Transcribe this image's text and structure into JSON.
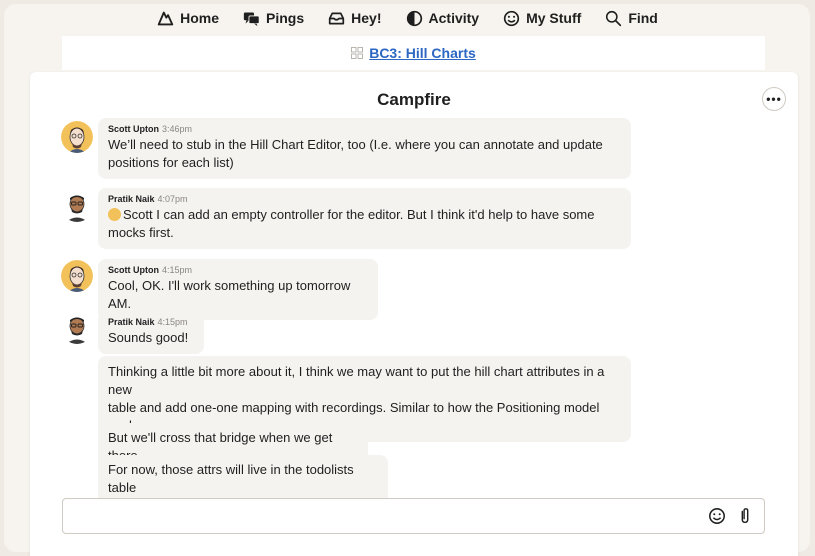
{
  "nav": {
    "items": [
      {
        "label": "Home",
        "icon": "home-icon"
      },
      {
        "label": "Pings",
        "icon": "pings-icon"
      },
      {
        "label": "Hey!",
        "icon": "hey-icon"
      },
      {
        "label": "Activity",
        "icon": "activity-icon"
      },
      {
        "label": "My Stuff",
        "icon": "my-stuff-icon"
      },
      {
        "label": "Find",
        "icon": "search-icon"
      }
    ]
  },
  "project": {
    "name": "BC3: Hill Charts",
    "icon": "project-grid-icon"
  },
  "campfire": {
    "title": "Campfire",
    "messages": [
      {
        "author": "Scott Upton",
        "time": "3:46pm",
        "lines": [
          "We’ll need to stub in the Hill Chart Editor, too (I.e. where you can annotate and update",
          "positions for each list)"
        ]
      },
      {
        "author": "Pratik Naik",
        "time": "4:07pm",
        "mention": "Scott",
        "lines": [
          "I can add an empty controller for the editor. But I think it'd help to have some",
          "mocks first."
        ]
      },
      {
        "author": "Scott Upton",
        "time": "4:15pm",
        "lines": [
          "Cool, OK. I'll work something up tomorrow AM."
        ]
      },
      {
        "author": "Pratik Naik",
        "time": "4:15pm",
        "lines": [
          "Sounds good!"
        ]
      },
      {
        "lines": [
          "Thinking a little bit more about it, I think we may want to put the hill chart attributes in a new",
          "table and add one-one mapping with recordings. Similar to how the Positioning model",
          "works."
        ]
      },
      {
        "lines": [
          "But we'll cross that bridge when we get there"
        ]
      },
      {
        "lines": [
          "For now, those attrs will live in the todolists table"
        ]
      }
    ]
  },
  "composer": {
    "placeholder": "",
    "emoji_icon": "smiley-icon",
    "attach_icon": "paperclip-icon"
  },
  "colors": {
    "link": "#2b67c3",
    "bubble": "#f5f3f0",
    "background": "#efeae3"
  }
}
